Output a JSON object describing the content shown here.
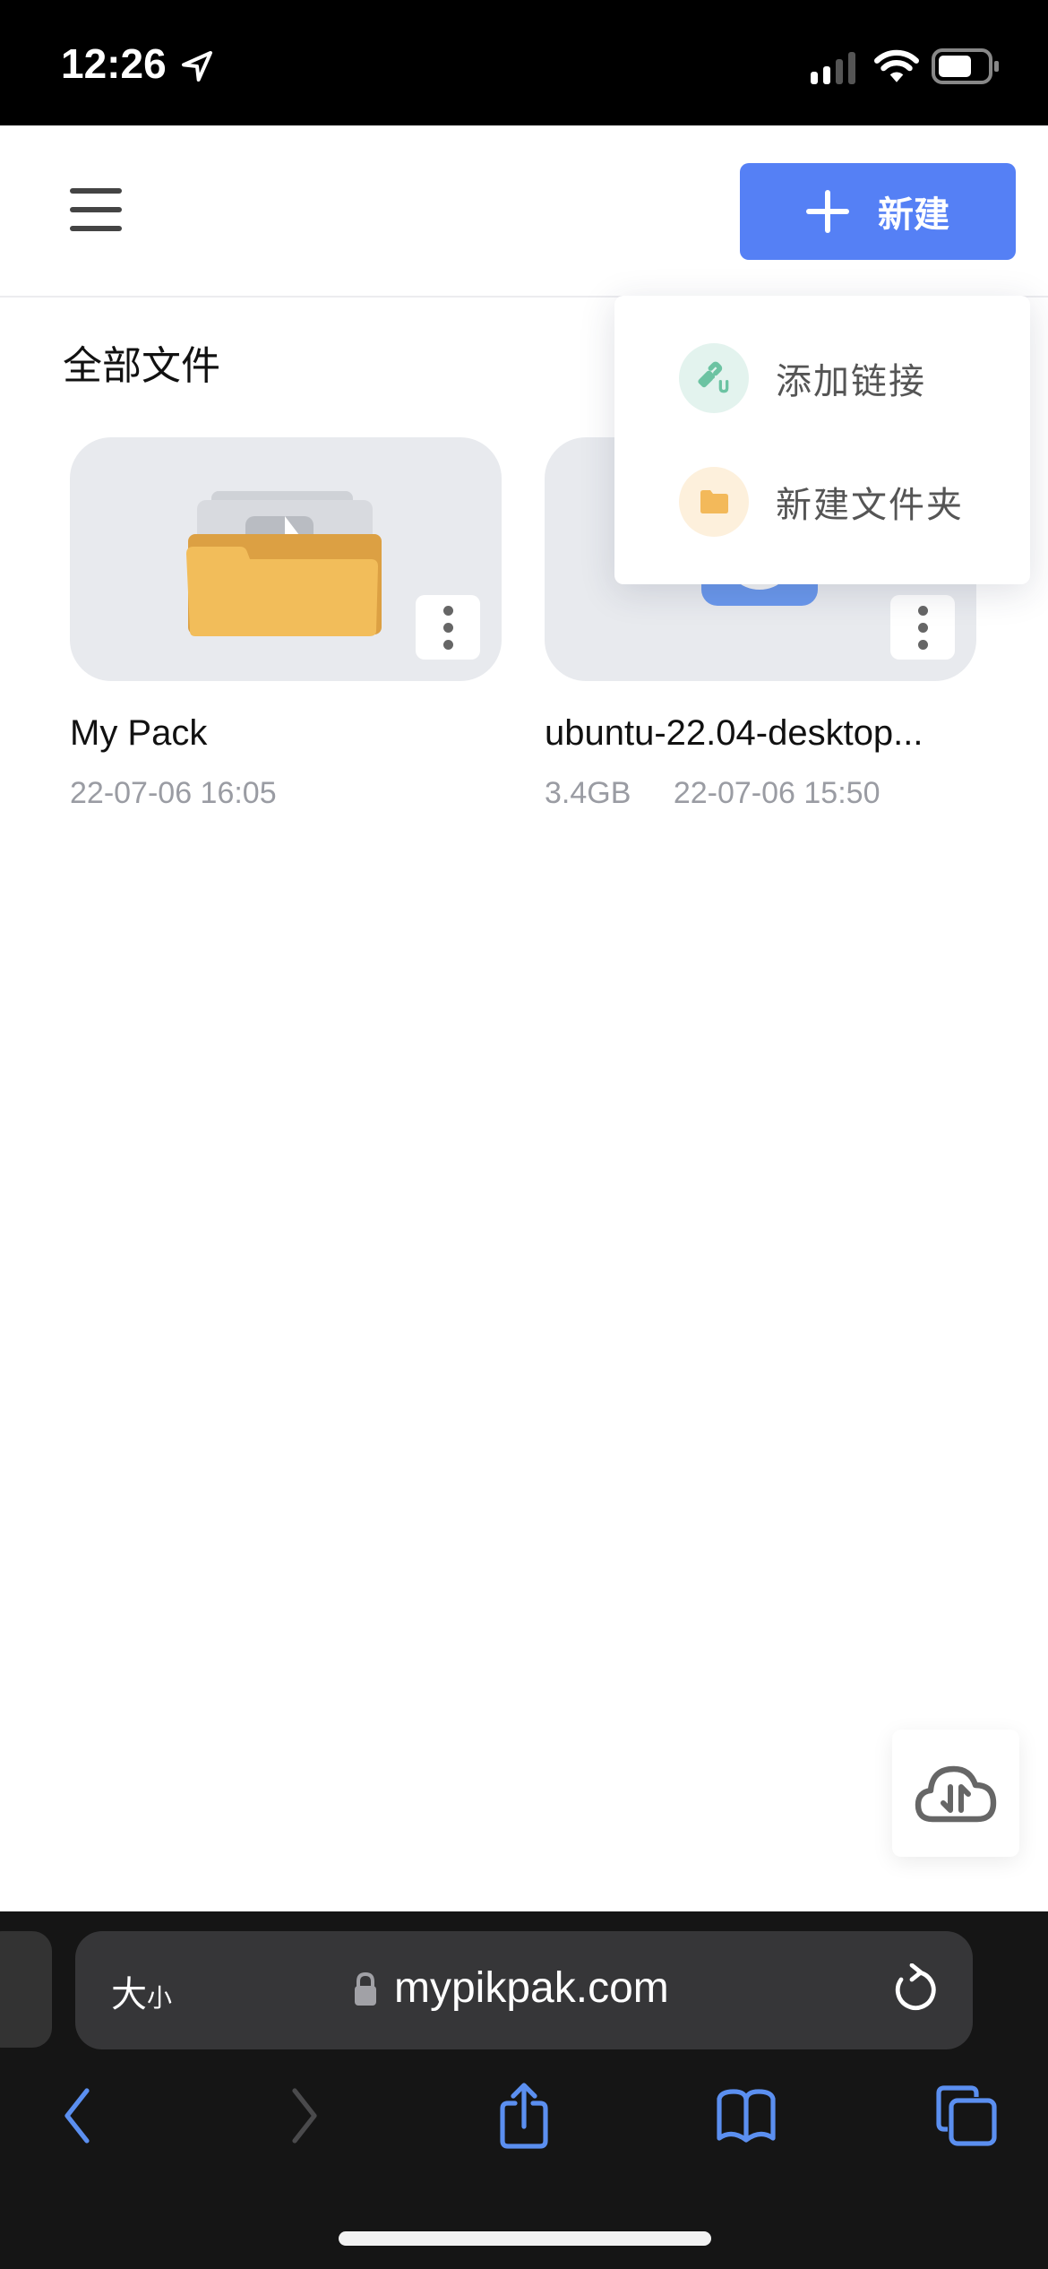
{
  "status_bar": {
    "time": "12:26",
    "icons": [
      "location-arrow-icon",
      "cellular-signal-icon",
      "wifi-icon",
      "battery-icon"
    ]
  },
  "header": {
    "menu_icon": "hamburger-menu-icon",
    "new_button": {
      "icon": "plus-icon",
      "label": "新建"
    },
    "accent_color": "#5580f5"
  },
  "main": {
    "section_title": "全部文件",
    "files": [
      {
        "name": "My Pack",
        "type": "folder",
        "size": "",
        "date": "22-07-06 16:05",
        "icon": "folder-icon"
      },
      {
        "name": "ubuntu-22.04-desktop...",
        "type": "iso",
        "size": "3.4GB",
        "date": "22-07-06 15:50",
        "icon": "disc-image-icon"
      }
    ]
  },
  "dropdown": {
    "items": [
      {
        "label": "添加链接",
        "icon": "magnet-link-icon",
        "color": "#6cc3a2"
      },
      {
        "label": "新建文件夹",
        "icon": "folder-icon",
        "color": "#f3b95a"
      }
    ]
  },
  "floating": {
    "icon": "cloud-transfer-icon"
  },
  "browser": {
    "text_size_label_big": "大",
    "text_size_label_small": "小",
    "url": "mypikpak.com",
    "toolbar": [
      "back-icon",
      "forward-icon",
      "share-icon",
      "bookmarks-icon",
      "tabs-icon"
    ]
  }
}
